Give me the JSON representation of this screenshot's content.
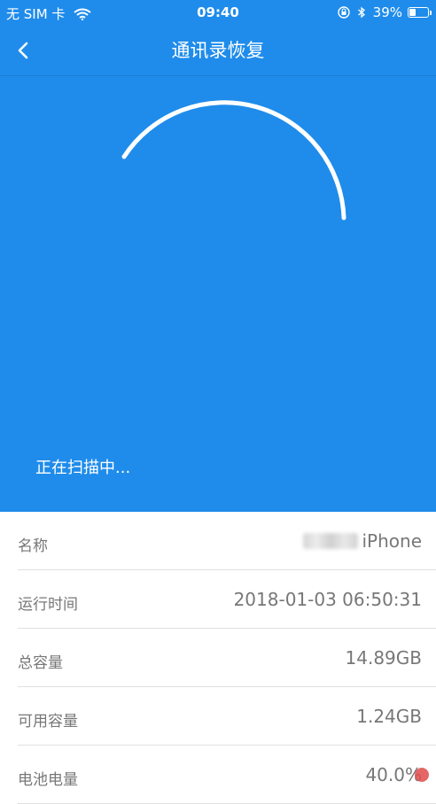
{
  "status_bar": {
    "carrier": "无 SIM 卡",
    "time": "09:40",
    "battery_percent": "39%",
    "battery_level": 0.39
  },
  "nav": {
    "title": "通讯录恢复"
  },
  "scan": {
    "status_text": "正在扫描中...",
    "arc_color": "#ffffff",
    "background_color": "#1f8ceb"
  },
  "info": {
    "rows": [
      {
        "label": "名称",
        "value": "iPhone"
      },
      {
        "label": "运行时间",
        "value": "2018-01-03 06:50:31"
      },
      {
        "label": "总容量",
        "value": "14.89GB"
      },
      {
        "label": "可用容量",
        "value": "1.24GB"
      },
      {
        "label": "电池电量",
        "value": "40.0%"
      }
    ]
  }
}
